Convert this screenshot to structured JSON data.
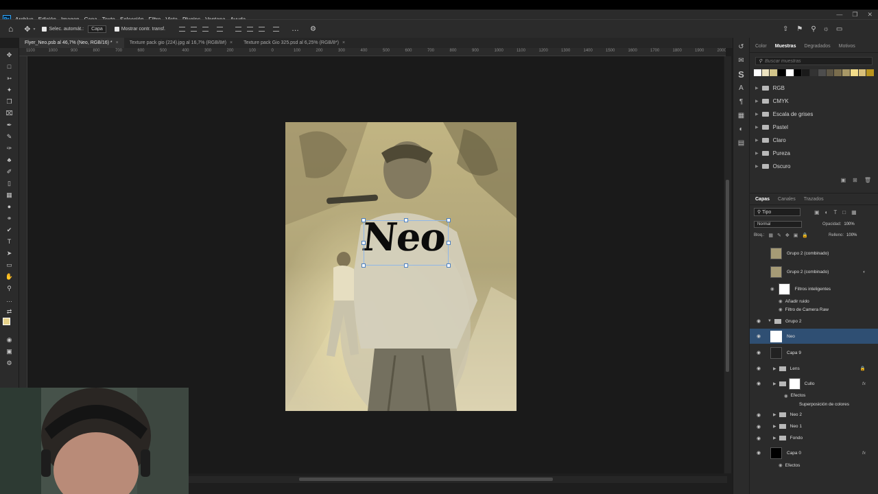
{
  "app": {
    "logo": "Ps"
  },
  "menu": [
    "Archivo",
    "Edición",
    "Imagen",
    "Capa",
    "Texto",
    "Selección",
    "Filtro",
    "Vista",
    "Plugins",
    "Ventana",
    "Ayuda"
  ],
  "options": {
    "auto_select": "Selec. automát.:",
    "auto_target": "Capa",
    "show_transform": "Mostrar contr. transf."
  },
  "tabs": [
    {
      "label": "Flyer_Neo.psb al 46,7% (Neo, RGB/16) *",
      "active": true
    },
    {
      "label": "Texture pack gio (224).jpg al 16,7% (RGB/8#)",
      "active": false
    },
    {
      "label": "Texture pack Gio 325.psd al 6,25% (RGB/8*)",
      "active": false
    }
  ],
  "ruler_marks": [
    "1100",
    "1000",
    "900",
    "800",
    "700",
    "600",
    "500",
    "400",
    "300",
    "200",
    "100",
    "0",
    "100",
    "200",
    "300",
    "400",
    "500",
    "600",
    "700",
    "800",
    "900",
    "1000",
    "1100",
    "1200",
    "1300",
    "1400",
    "1500",
    "1600",
    "1700",
    "1800",
    "1900",
    "2000"
  ],
  "artwork": {
    "title_text": "Neo"
  },
  "swatches_panel": {
    "tabs": [
      "Color",
      "Muestras",
      "Degradados",
      "Motivos"
    ],
    "active_tab": "Muestras",
    "search_placeholder": "Buscar muestras",
    "colors": [
      "#ffffff",
      "#ece3c0",
      "#d2c48a",
      "#000000",
      "#ffffff",
      "#000000",
      "#1a1a1a",
      "#333333",
      "#4d4d4d",
      "#5c5545",
      "#7a6d4d",
      "#a89867",
      "#f3dd8a",
      "#d9c07b",
      "#b8941e"
    ],
    "folders": [
      "RGB",
      "CMYK",
      "Escala de grises",
      "Pastel",
      "Claro",
      "Pureza",
      "Oscuro"
    ]
  },
  "layers_panel": {
    "tabs": [
      "Capas",
      "Canales",
      "Trazados"
    ],
    "active_tab": "Capas",
    "filter": "Tipo",
    "blend_mode": "Normal",
    "opacity_label": "Opacidad:",
    "opacity": "100%",
    "lock_label": "Bloq.:",
    "fill_label": "Relleno:",
    "fill": "100%",
    "layers": [
      {
        "name": "Grupo 2 (combinado)",
        "kind": "smart"
      },
      {
        "name": "Grupo 2 (combinado)",
        "kind": "smart"
      },
      {
        "name": "Filtros inteligentes",
        "kind": "filtermask"
      },
      {
        "name": "Añadir ruido",
        "kind": "filter"
      },
      {
        "name": "Filtro de Camera Raw",
        "kind": "filter"
      },
      {
        "name": "Grupo 2",
        "kind": "group"
      },
      {
        "name": "Neo",
        "kind": "layer",
        "selected": true
      },
      {
        "name": "Capa 9",
        "kind": "layer"
      },
      {
        "name": "Lens",
        "kind": "group"
      },
      {
        "name": "Cullo",
        "kind": "layer"
      },
      {
        "name": "Efectos",
        "kind": "effects"
      },
      {
        "name": "Superposición de colores",
        "kind": "effect"
      },
      {
        "name": "Neo 2",
        "kind": "group"
      },
      {
        "name": "Neo 1",
        "kind": "group"
      },
      {
        "name": "Fondo",
        "kind": "group"
      },
      {
        "name": "Capa 0",
        "kind": "layer"
      },
      {
        "name": "Efectos",
        "kind": "effects"
      }
    ]
  }
}
